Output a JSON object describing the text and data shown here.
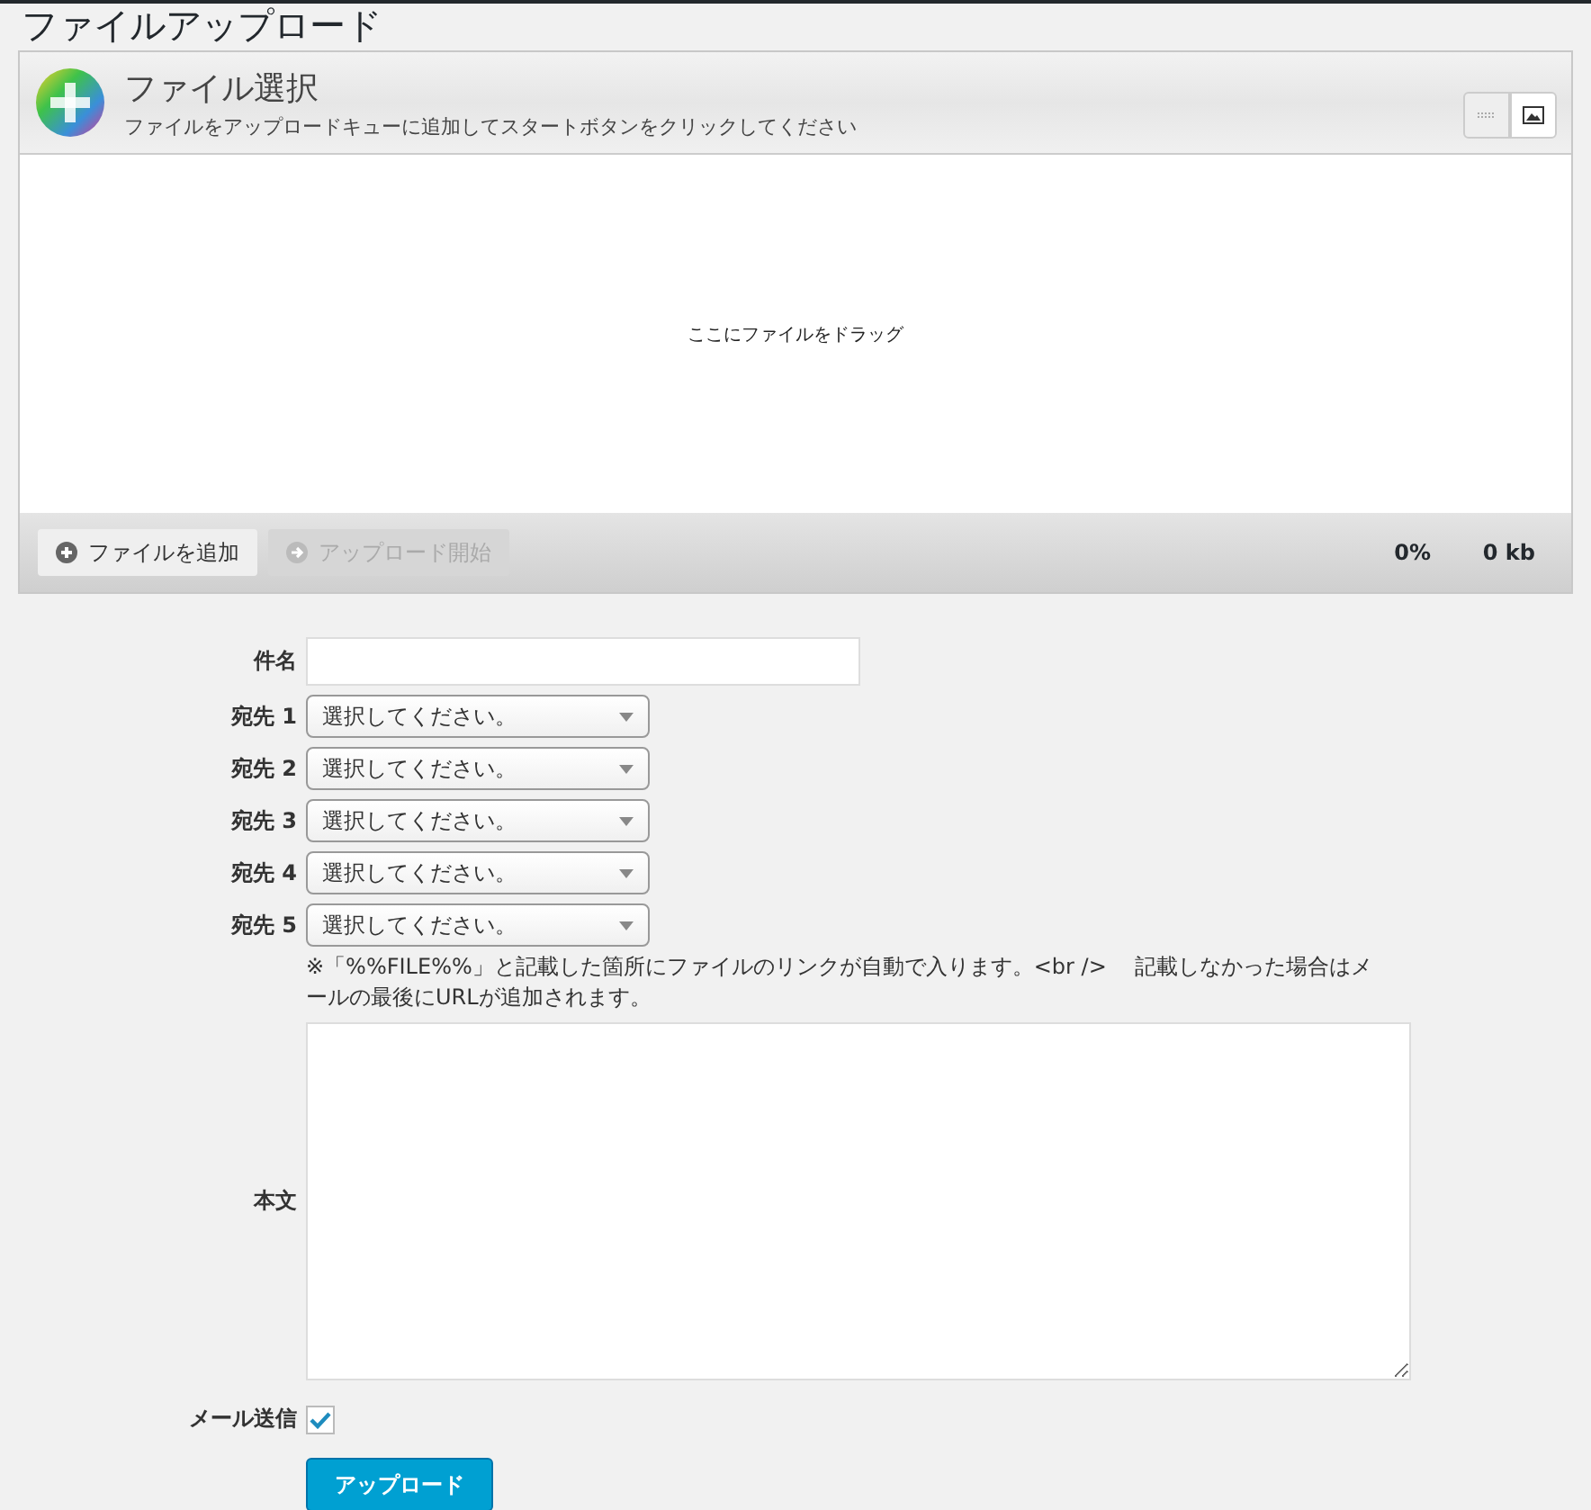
{
  "page": {
    "title": "ファイルアップロード"
  },
  "uploader": {
    "title": "ファイル選択",
    "subtitle": "ファイルをアップロードキューに追加してスタートボタンをクリックしてください",
    "views": [
      {
        "kind": "list",
        "selected": false
      },
      {
        "kind": "thumbs",
        "selected": true
      }
    ],
    "drop_text": "ここにファイルをドラッグ",
    "buttons": [
      {
        "kind": "add",
        "label": "ファイルを追加",
        "disabled": false
      },
      {
        "kind": "start",
        "label": "アップロード開始",
        "disabled": true
      }
    ],
    "percent": "0%",
    "size": "0 kb"
  },
  "form": {
    "subject_label": "件名",
    "recipients": [
      {
        "label": "宛先 1",
        "value": "選択してください。"
      },
      {
        "label": "宛先 2",
        "value": "選択してください。"
      },
      {
        "label": "宛先 3",
        "value": "選択してください。"
      },
      {
        "label": "宛先 4",
        "value": "選択してください。"
      },
      {
        "label": "宛先 5",
        "value": "選択してください。"
      }
    ],
    "note": "※「%%FILE%%」と記載した箇所にファイルのリンクが自動で入ります。<br />　 記載しなかった場合はメールの最後にURLが追加されます。",
    "body_label": "本文",
    "mail_label": "メール送信",
    "mail_checked": true,
    "submit": "アップロード"
  }
}
